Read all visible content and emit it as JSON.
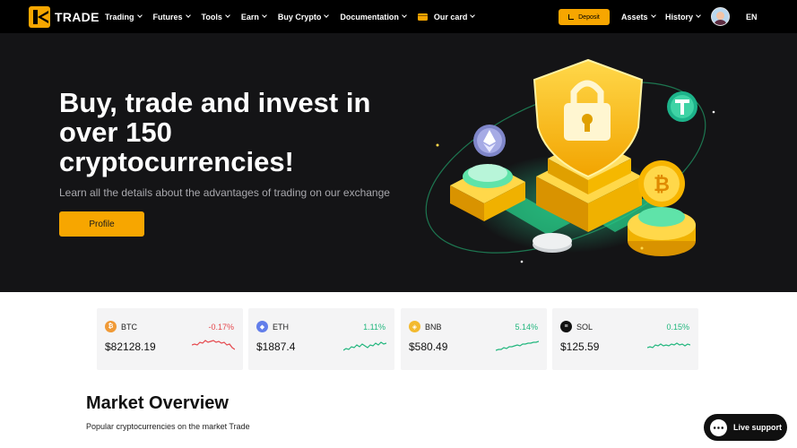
{
  "brand": {
    "name": "TRADE",
    "accent": "#f7a600"
  },
  "nav": {
    "items": [
      {
        "label": "Trading"
      },
      {
        "label": "Futures"
      },
      {
        "label": "Tools"
      },
      {
        "label": "Earn"
      },
      {
        "label": "Buy Crypto"
      },
      {
        "label": "Documentation"
      }
    ],
    "our_card": "Our card",
    "deposit": "Deposit",
    "assets": "Assets",
    "history": "History",
    "lang": "EN"
  },
  "hero": {
    "title": "Buy, trade and invest in over 150 cryptocurrencies!",
    "subtitle": "Learn all the details about the advantages of trading on our exchange",
    "button": "Profile"
  },
  "tickers": [
    {
      "symbol": "BTC",
      "change": "-0.17%",
      "price": "$82128.19",
      "color": "#f09a37",
      "trend": "down",
      "icon": "bitcoin-icon"
    },
    {
      "symbol": "ETH",
      "change": "1.11%",
      "price": "$1887.4",
      "color": "#627eea",
      "trend": "up",
      "icon": "ethereum-icon"
    },
    {
      "symbol": "BNB",
      "change": "5.14%",
      "price": "$580.49",
      "color": "#f3ba2f",
      "trend": "up",
      "icon": "bnb-icon"
    },
    {
      "symbol": "SOL",
      "change": "0.15%",
      "price": "$125.59",
      "color": "#111111",
      "trend": "up",
      "icon": "solana-icon"
    }
  ],
  "market": {
    "title": "Market Overview",
    "subtitle": "Popular cryptocurrencies on the market Trade"
  },
  "support": {
    "label": "Live support"
  },
  "colors": {
    "up": "#21b67d",
    "down": "#e5484d"
  }
}
